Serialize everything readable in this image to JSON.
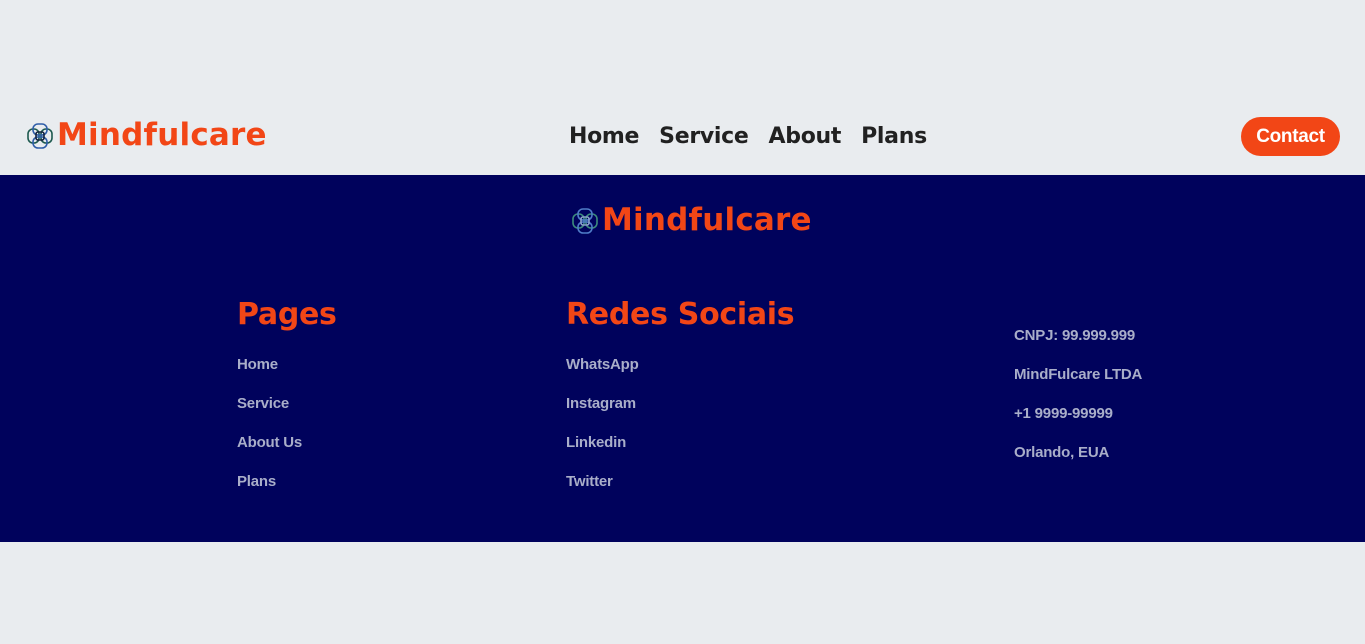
{
  "brand": {
    "name": "Mindfulcare",
    "accent_color": "#f24616",
    "icon": "brain-icon"
  },
  "nav": {
    "items": [
      "Home",
      "Service",
      "About",
      "Plans"
    ],
    "contact_label": "Contact"
  },
  "footer": {
    "background_color": "#00025c",
    "pages": {
      "title": "Pages",
      "links": [
        "Home",
        "Service",
        "About Us",
        "Plans"
      ]
    },
    "social": {
      "title": "Redes Sociais",
      "links": [
        "WhatsApp",
        "Instagram",
        "Linkedin",
        "Twitter"
      ]
    },
    "info": {
      "lines": [
        "CNPJ: 99.999.999",
        "MindFulcare LTDA",
        "+1 9999-99999",
        "Orlando, EUA"
      ]
    }
  }
}
